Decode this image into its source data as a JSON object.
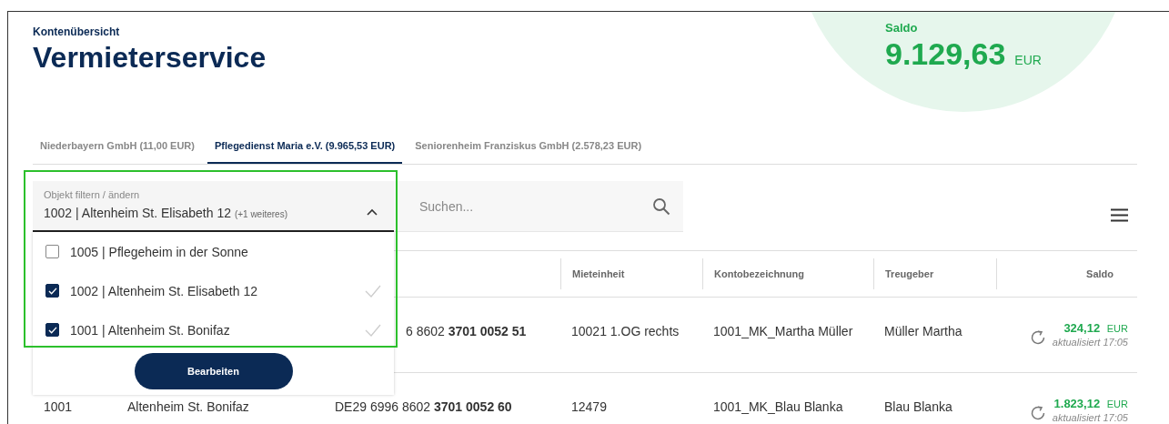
{
  "header": {
    "overline": "Kontenübersicht",
    "title": "Vermieterservice"
  },
  "balance": {
    "label": "Saldo",
    "amount": "9.129,63",
    "currency": "EUR"
  },
  "tabs": [
    {
      "label": "Niederbayern GmbH (11,00 EUR)",
      "selected": false
    },
    {
      "label": "Pflegedienst Maria e.V. (9.965,53 EUR)",
      "selected": true
    },
    {
      "label": "Seniorenheim Franziskus GmbH (2.578,23 EUR)",
      "selected": false
    }
  ],
  "filter": {
    "label": "Objekt filtern / ändern",
    "value": "1002 | Altenheim St. Elisabeth 12",
    "extra": "(+1 weiteres)",
    "expanded": true,
    "options": [
      {
        "label": "1005 | Pflegeheim in der Sonne",
        "checked": false
      },
      {
        "label": "1002 | Altenheim St. Elisabeth 12",
        "checked": true
      },
      {
        "label": "1001 | Altenheim St. Bonifaz",
        "checked": true
      }
    ],
    "button": "Bearbeiten"
  },
  "search": {
    "placeholder": "Suchen..."
  },
  "table": {
    "columns": [
      "Mieteinheit",
      "Kontobezeichnung",
      "Treugeber",
      "Saldo"
    ],
    "rows": [
      {
        "column_3": "6 8602 **3701 0052 51**",
        "mieteinheit": "10021 1.OG rechts",
        "kontobezeichnung": "1001_MK_Martha Müller",
        "treugeber": "Müller Martha",
        "saldo": "324,12",
        "currency": "EUR",
        "updated": "aktualisiert 17:05"
      },
      {
        "column_1": "1001",
        "column_2": "Altenheim St. Bonifaz",
        "column_3": "DE29 6996 8602 **3701 0052 60**",
        "mieteinheit": "12479",
        "kontobezeichnung": "1001_MK_Blau Blanka",
        "treugeber": "Blau Blanka",
        "saldo": "1.823,12",
        "currency": "EUR",
        "updated": "aktualisiert 17:05"
      }
    ]
  }
}
